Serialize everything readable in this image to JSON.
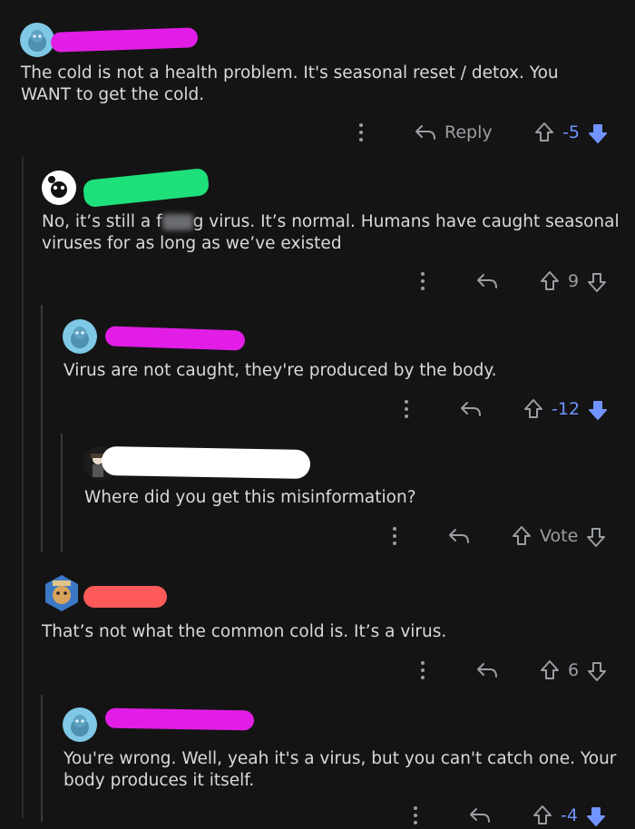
{
  "comments": [
    {
      "text": "The cold is not a health problem. It's seasonal reset / detox. You WANT to get the cold.",
      "reply_label": "Reply",
      "score": "-5",
      "scribble_color": "#e21ee6"
    },
    {
      "text_before": "No, it’s still a f",
      "text_after": "g virus. It’s normal. Humans have caught seasonal viruses for as long as we’ve existed",
      "score": "9",
      "scribble_color": "#1ee07a"
    },
    {
      "text": "Virus are not caught, they're produced by the body.",
      "score": "-12",
      "scribble_color": "#e21ee6"
    },
    {
      "text": "Where did you get this misinformation?",
      "score": "Vote",
      "scribble_color": "#ffffff"
    },
    {
      "text": "That’s not what the common cold is. It’s a virus.",
      "score": "6",
      "scribble_color": "#ff5a5a"
    },
    {
      "text": "You're wrong. Well, yeah it's a virus, but you can't catch one. Your body produces it itself.",
      "score": "-4",
      "scribble_color": "#e21ee6"
    }
  ],
  "colors": {
    "background": "#141414",
    "text": "#d7dadc",
    "muted": "#9a9ea3",
    "downvote_active": "#7193ff"
  },
  "icons": [
    "more-icon",
    "reply-arrow-icon",
    "upvote-arrow-icon",
    "downvote-arrow-icon",
    "avatar-snoo-icon"
  ]
}
